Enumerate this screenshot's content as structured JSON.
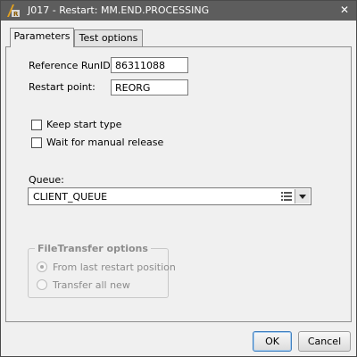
{
  "window": {
    "title": "J017 - Restart: MM.END.PROCESSING",
    "close_glyph": "✕"
  },
  "tabs": [
    {
      "label": "Parameters",
      "active": true
    },
    {
      "label": "Test options",
      "active": false
    }
  ],
  "form": {
    "reference_runid_label": "Reference RunID:",
    "reference_runid_value": "86311088",
    "restart_point_label": "Restart point:",
    "restart_point_value": "REORG",
    "keep_start_type_label": "Keep start type",
    "keep_start_type_checked": false,
    "wait_manual_release_label": "Wait for manual release",
    "wait_manual_release_checked": false,
    "queue_label": "Queue:",
    "queue_value": "CLIENT_QUEUE"
  },
  "file_transfer": {
    "legend": "FileTransfer options",
    "enabled": false,
    "options": [
      {
        "label": "From last restart position",
        "selected": true
      },
      {
        "label": "Transfer all new",
        "selected": false
      }
    ]
  },
  "buttons": {
    "ok_label": "OK",
    "cancel_label": "Cancel"
  },
  "colors": {
    "titlebar": "#5d5d5d",
    "accent": "#3f7fbf",
    "disabled_text": "#8c8c8c"
  },
  "icons": {
    "app": "automic-restart-icon",
    "close": "close-icon",
    "queue_list": "list-icon",
    "dropdown": "chevron-down-icon"
  }
}
